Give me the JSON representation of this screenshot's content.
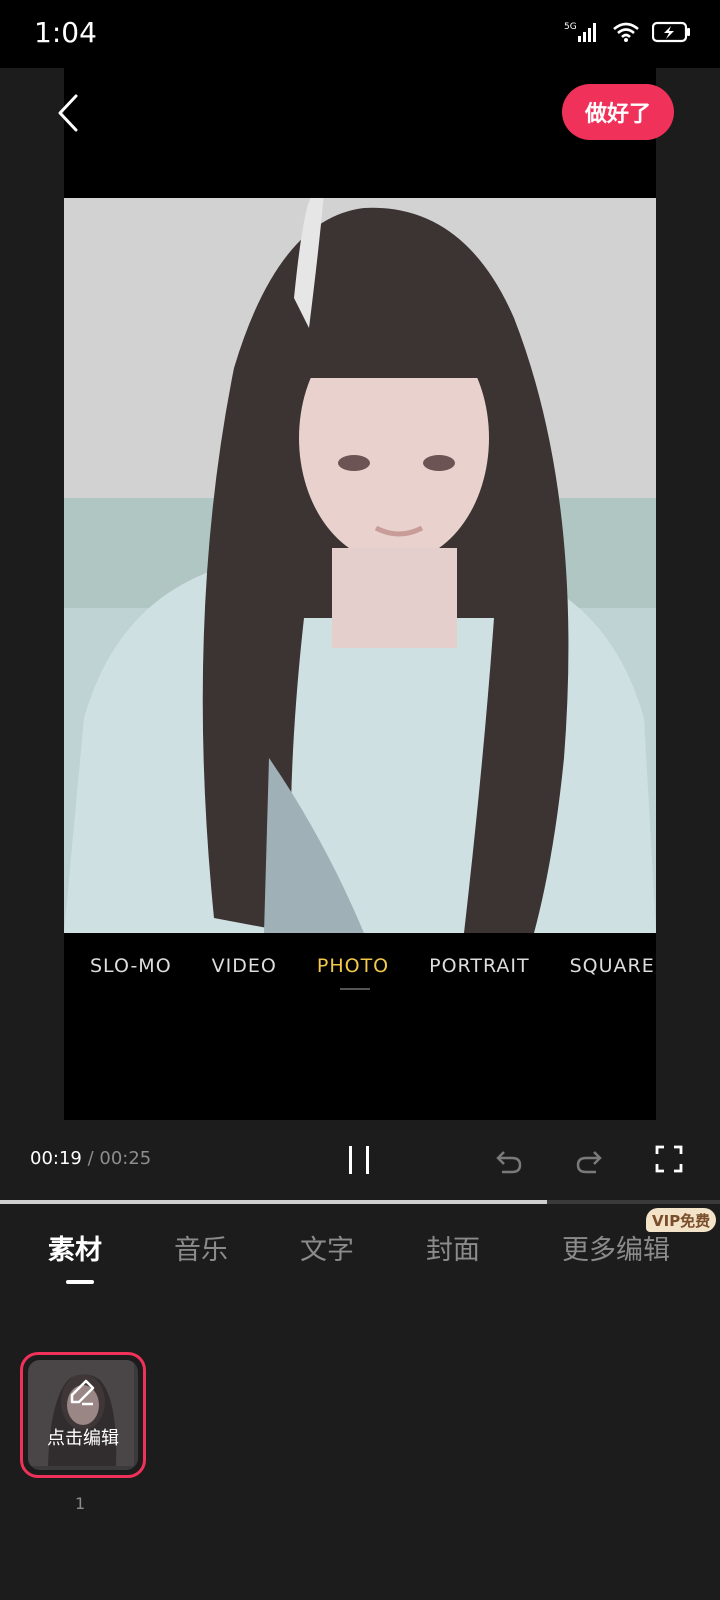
{
  "status_bar": {
    "time": "1:04",
    "network": "5G"
  },
  "header": {
    "done_label": "做好了"
  },
  "preview": {
    "camera_modes": [
      "SLO-MO",
      "VIDEO",
      "PHOTO",
      "PORTRAIT",
      "SQUARE"
    ],
    "active_mode": "PHOTO"
  },
  "playback": {
    "current": "00:19",
    "separator": " / ",
    "total": "00:25",
    "progress": 0.76
  },
  "tabs": [
    {
      "label": "素材",
      "active": true
    },
    {
      "label": "音乐",
      "active": false
    },
    {
      "label": "文字",
      "active": false
    },
    {
      "label": "封面",
      "active": false
    },
    {
      "label": "更多编辑",
      "active": false
    }
  ],
  "vip_badge": "VIP免费",
  "clips": [
    {
      "edit_label": "点击编辑",
      "index": "1"
    }
  ],
  "colors": {
    "accent": "#f0315a",
    "mode_active": "#f2c94c",
    "background": "#1c1c1c"
  },
  "icons": [
    "back-icon",
    "pause-icon",
    "undo-icon",
    "redo-icon",
    "fullscreen-icon",
    "edit-icon",
    "signal-icon",
    "wifi-icon",
    "battery-icon"
  ]
}
